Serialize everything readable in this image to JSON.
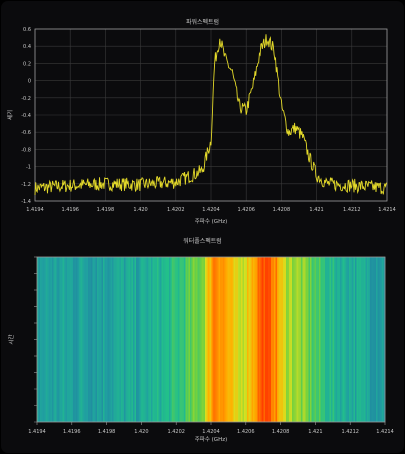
{
  "colors": {
    "background": "#0b0b0d",
    "grid": "#3a3a3a",
    "axis": "#9a9a9a",
    "text": "#c8c8c8",
    "trace": "#e3d92a",
    "colormap": [
      "#1f6fa0",
      "#20a0a0",
      "#22c08a",
      "#6ed040",
      "#d7e020",
      "#ffb000",
      "#ff6a00",
      "#ff3a00"
    ]
  },
  "top_panel": {
    "title": "파워스펙트럼"
  },
  "bottom_panel": {
    "title": "워터폴스펙트럼"
  },
  "chart_data": [
    {
      "type": "line",
      "title": "파워스펙트럼",
      "xlabel": "주파수 (GHz)",
      "ylabel": "세기",
      "xlim": [
        1.4194,
        1.4214
      ],
      "ylim": [
        -1.4,
        0.6
      ],
      "x_ticks": [
        "1.4194",
        "1.4196",
        "1.4198",
        "1.420",
        "1.4202",
        "1.4204",
        "1.4206",
        "1.4208",
        "1.421",
        "1.4212",
        "1.4214"
      ],
      "y_ticks": [
        "0.6",
        "0.4",
        "0.2",
        "0",
        "-0.2",
        "-0.4",
        "-0.6",
        "-0.8",
        "-1",
        "-1.2",
        "-1.4"
      ],
      "grid": true,
      "series": [
        {
          "color": "#e3d92a",
          "x": [
            1.4194,
            1.4196,
            1.4198,
            1.42,
            1.4202,
            1.42035,
            1.4204,
            1.42042,
            1.42045,
            1.42048,
            1.42052,
            1.42056,
            1.4206,
            1.42064,
            1.42068,
            1.42072,
            1.42076,
            1.4208,
            1.42084,
            1.42088,
            1.42092,
            1.42096,
            1.421,
            1.42106,
            1.4212,
            1.4214
          ],
          "y": [
            -1.25,
            -1.22,
            -1.2,
            -1.21,
            -1.18,
            -1.05,
            -0.7,
            0.2,
            0.5,
            0.25,
            0.1,
            -0.3,
            -0.35,
            -0.05,
            0.35,
            0.5,
            0.35,
            -0.3,
            -0.6,
            -0.55,
            -0.65,
            -0.9,
            -1.1,
            -1.2,
            -1.22,
            -1.25
          ]
        }
      ]
    },
    {
      "type": "heatmap",
      "title": "워터폴스펙트럼",
      "xlabel": "주파수 (GHz)",
      "ylabel": "시간",
      "xlim": [
        1.4194,
        1.4214
      ],
      "x_ticks": [
        "1.4194",
        "1.4196",
        "1.4198",
        "1.420",
        "1.4202",
        "1.4204",
        "1.4206",
        "1.4208",
        "1.421",
        "1.4212",
        "1.4214"
      ],
      "intensity_profile": {
        "x": [
          1.4194,
          1.42,
          1.4202,
          1.42035,
          1.42042,
          1.42048,
          1.42056,
          1.42064,
          1.4207,
          1.42076,
          1.42082,
          1.4209,
          1.421,
          1.4211,
          1.4214
        ],
        "level": [
          0.15,
          0.18,
          0.28,
          0.45,
          0.85,
          0.75,
          0.52,
          0.72,
          0.95,
          0.85,
          0.55,
          0.48,
          0.36,
          0.24,
          0.15
        ]
      }
    }
  ]
}
